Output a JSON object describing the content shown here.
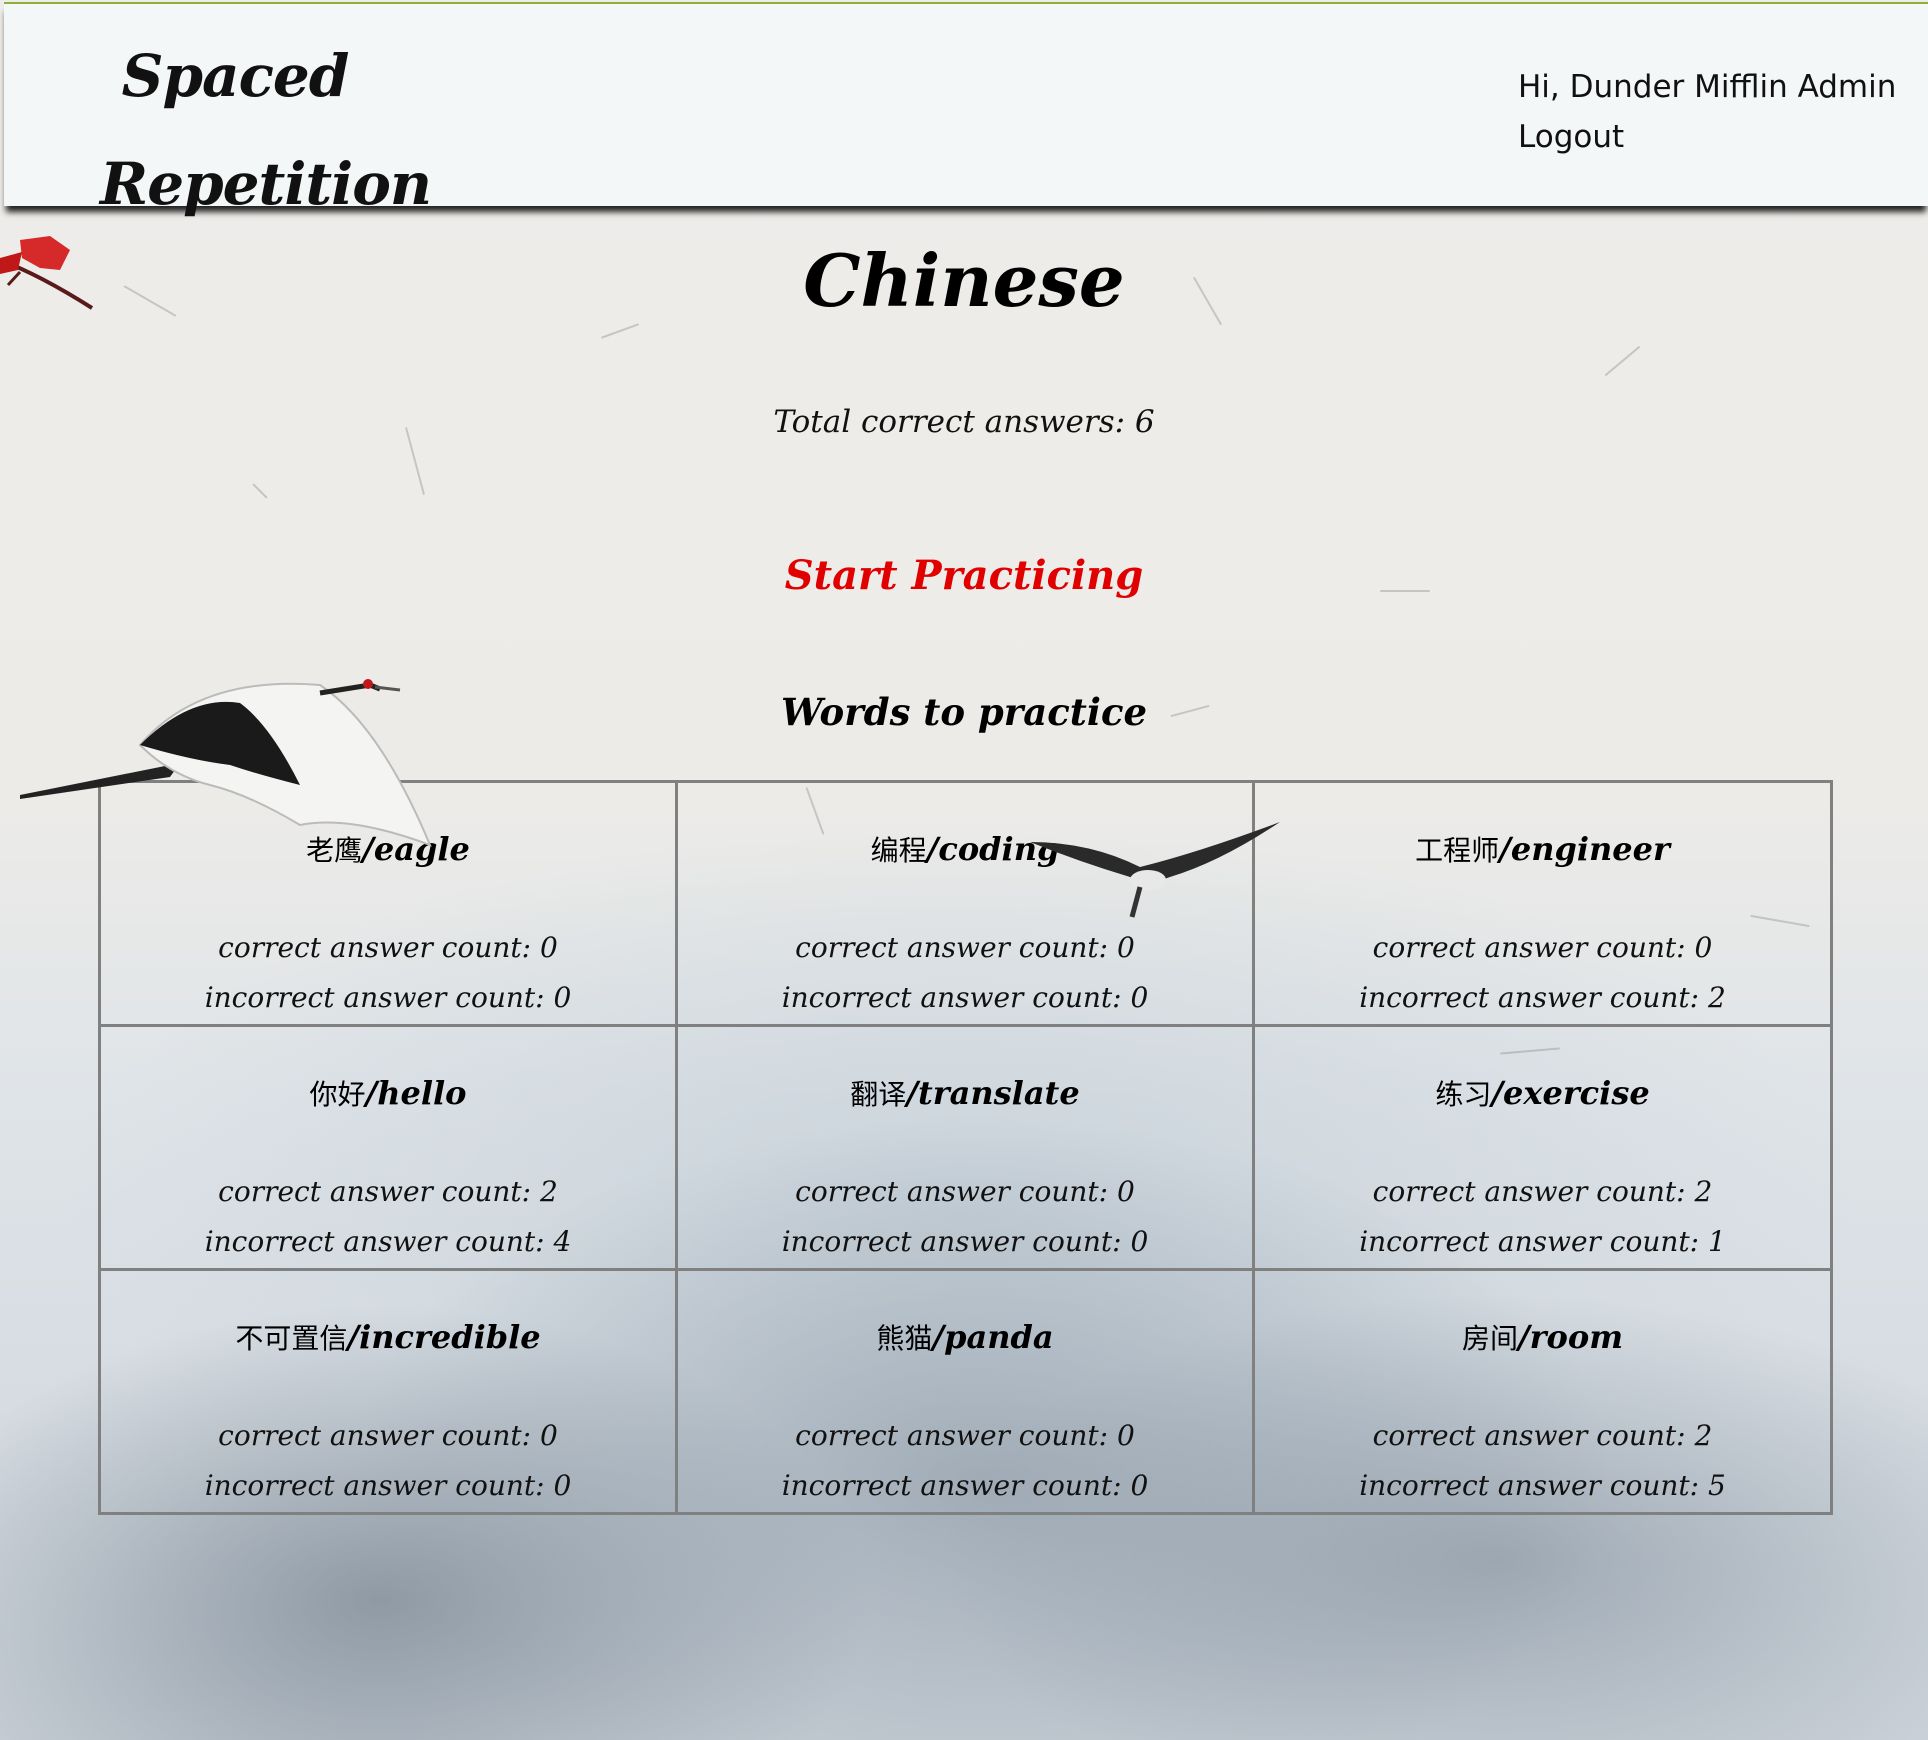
{
  "header": {
    "logo_line1": "Spaced",
    "logo_line2": "Repetition",
    "greeting": "Hi, Dunder Mifflin Admin",
    "logout_label": "Logout"
  },
  "language": {
    "title": "Chinese",
    "total_correct": "Total correct answers: 6",
    "start_label": "Start Practicing",
    "words_heading": "Words to practice"
  },
  "words": [
    {
      "cn": "老鹰",
      "en": "/eagle",
      "correct": "correct answer count: 0",
      "incorrect": "incorrect answer count: 0"
    },
    {
      "cn": "编程",
      "en": "/coding",
      "correct": "correct answer count: 0",
      "incorrect": "incorrect answer count: 0"
    },
    {
      "cn": "工程师",
      "en": "/engineer",
      "correct": "correct answer count: 0",
      "incorrect": "incorrect answer count: 2"
    },
    {
      "cn": "你好",
      "en": "/hello",
      "correct": "correct answer count: 2",
      "incorrect": "incorrect answer count: 4"
    },
    {
      "cn": "翻译",
      "en": "/translate",
      "correct": "correct answer count: 0",
      "incorrect": "incorrect answer count: 0"
    },
    {
      "cn": "练习",
      "en": "/exercise",
      "correct": "correct answer count: 2",
      "incorrect": "incorrect answer count: 1"
    },
    {
      "cn": "不可置信",
      "en": "/incredible",
      "correct": "correct answer count: 0",
      "incorrect": "incorrect answer count: 0"
    },
    {
      "cn": "熊猫",
      "en": "/panda",
      "correct": "correct answer count: 0",
      "incorrect": "incorrect answer count: 0"
    },
    {
      "cn": "房间",
      "en": "/room",
      "correct": "correct answer count: 2",
      "incorrect": "incorrect answer count: 5"
    }
  ],
  "colors": {
    "accent_red": "#e00000",
    "header_bg": "#f4f7f8",
    "card_border": "#808080"
  }
}
